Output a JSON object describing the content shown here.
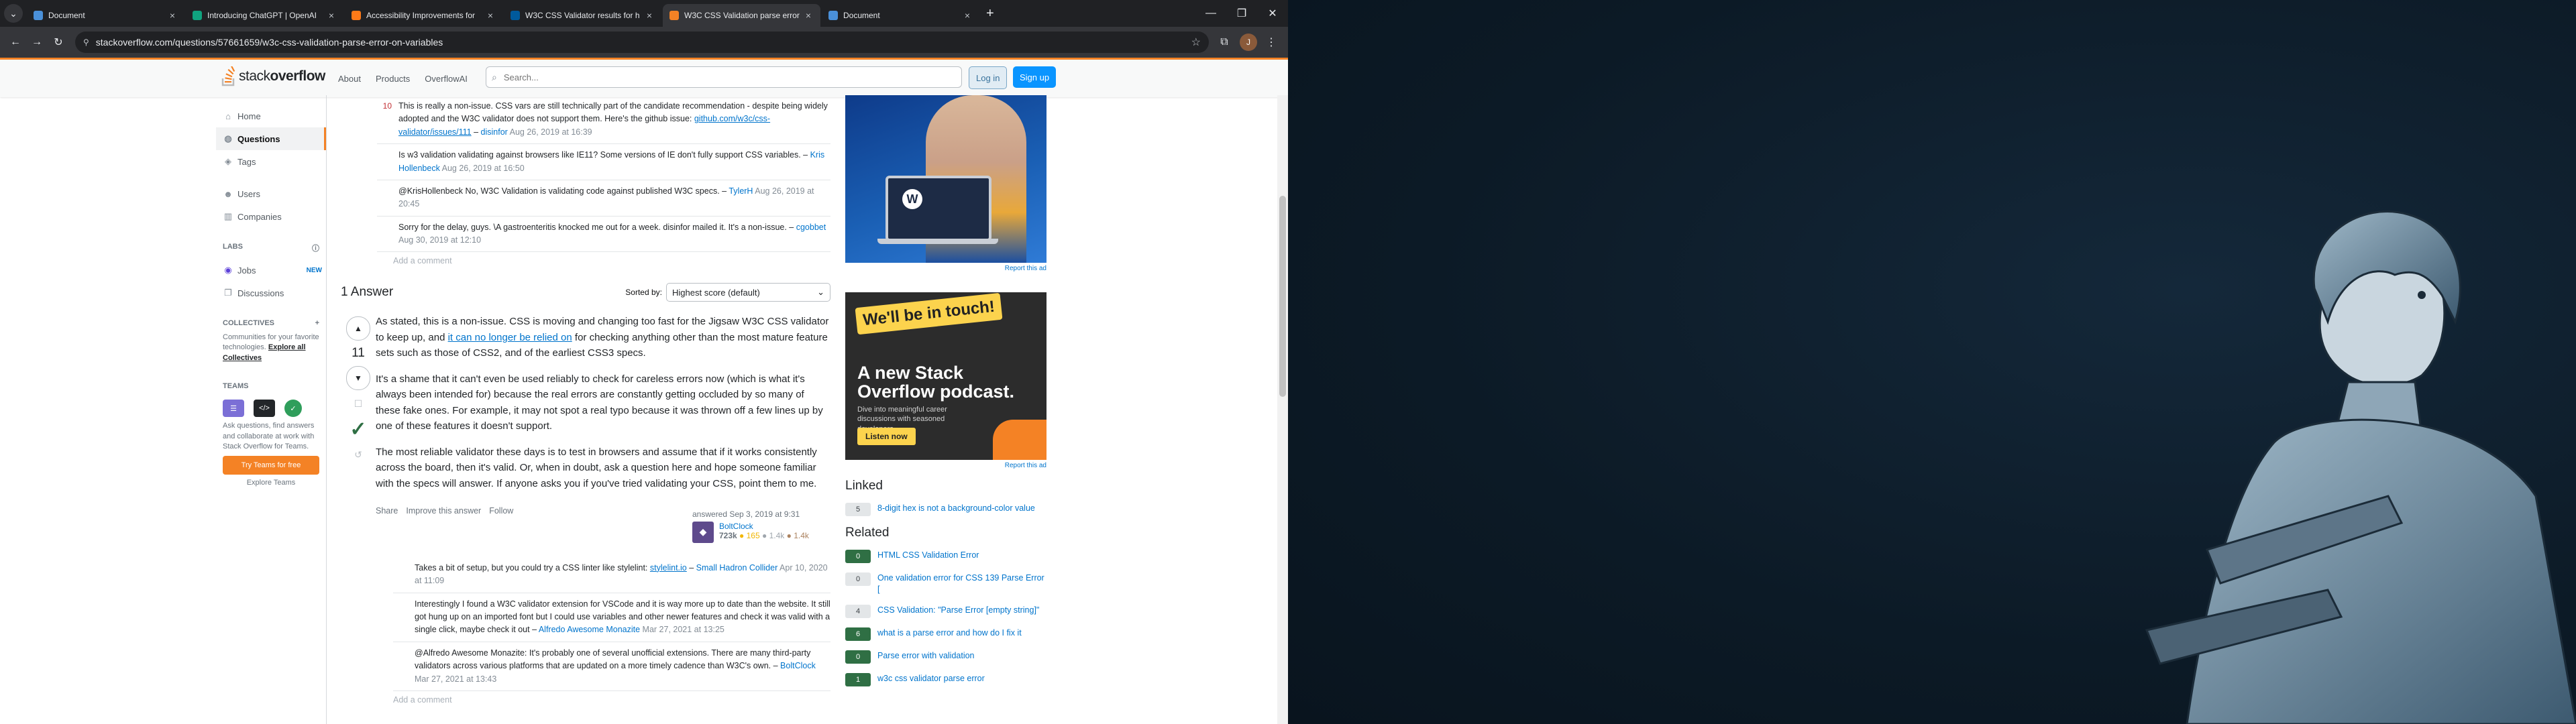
{
  "browser": {
    "tabs": [
      {
        "title": "Document",
        "color": "#4a90d9",
        "active": false
      },
      {
        "title": "Introducing ChatGPT | OpenAI",
        "color": "#10a37f",
        "active": false
      },
      {
        "title": "Accessibility Improvements for",
        "color": "#ff7a18",
        "active": false
      },
      {
        "title": "W3C CSS Validator results for h",
        "color": "#005a9c",
        "active": false
      },
      {
        "title": "W3C CSS Validation parse error",
        "color": "#f48225",
        "active": true
      },
      {
        "title": "Document",
        "color": "#4a90d9",
        "active": false
      }
    ],
    "url": "stackoverflow.com/questions/57661659/w3c-css-validation-parse-error-on-variables",
    "avatar_letter": "J"
  },
  "so": {
    "logo_plain": "stack",
    "logo_bold": "overflow",
    "nav": [
      "About",
      "Products",
      "OverflowAI"
    ],
    "search_placeholder": "Search...",
    "login": "Log in",
    "signup": "Sign up"
  },
  "sidebar": {
    "home": "Home",
    "questions": "Questions",
    "tags": "Tags",
    "users": "Users",
    "companies": "Companies",
    "labs": "LABS",
    "jobs": "Jobs",
    "jobs_badge": "NEW",
    "discussions": "Discussions",
    "collectives": "COLLECTIVES",
    "collectives_text": "Communities for your favorite technologies.",
    "collectives_link": "Explore all Collectives",
    "teams": "TEAMS",
    "teams_text": "Ask questions, find answers and collaborate at work with Stack Overflow for Teams.",
    "teams_btn": "Try Teams for free",
    "teams_explore": "Explore Teams"
  },
  "question_comments": [
    {
      "score": "10",
      "text": "This is really a non-issue. CSS vars are still technically part of the candidate recommendation - despite being widely adopted and the W3C validator does not support them. Here's the github issue: ",
      "link": "github.com/w3c/css-validator/issues/111",
      "dash": " – ",
      "user": "disinfor",
      "date": "Aug 26, 2019 at 16:39"
    },
    {
      "score": "",
      "text": "Is w3 validation validating against browsers like IE11? Some versions of IE don't fully support CSS variables.",
      "link": "",
      "dash": " – ",
      "user": "Kris Hollenbeck",
      "date": "Aug 26, 2019 at 16:50"
    },
    {
      "score": "",
      "text": "@KrisHollenbeck No, W3C Validation is validating code against published W3C specs.",
      "link": "",
      "dash": " – ",
      "user": "TylerH",
      "date": "Aug 26, 2019 at 20:45"
    },
    {
      "score": "",
      "text": "Sorry for the delay, guys. \\A gastroenteritis knocked me out for a week. disinfor mailed it. It's a non-issue.",
      "link": "",
      "dash": " – ",
      "user": "cgobbet",
      "date": "Aug 30, 2019 at 12:10"
    }
  ],
  "add_comment": "Add a comment",
  "answers": {
    "count_label": "1 Answer",
    "sorted_by": "Sorted by:",
    "sort_value": "Highest score (default)"
  },
  "answer": {
    "score": "11",
    "p1_a": "As stated, this is a non-issue. CSS is moving and changing too fast for the Jigsaw W3C CSS validator to keep up, and ",
    "p1_link": "it can no longer be relied on",
    "p1_b": " for checking anything other than the most mature feature sets such as those of CSS2, and of the earliest CSS3 specs.",
    "p2": "It's a shame that it can't even be used reliably to check for careless errors now (which is what it's always been intended for) because the real errors are constantly getting occluded by so many of these fake ones. For example, it may not spot a real typo because it was thrown off a few lines up by one of these features it doesn't support.",
    "p3": "The most reliable validator these days is to test in browsers and assume that if it works consistently across the board, then it's valid. Or, when in doubt, ask a question here and hope someone familiar with the specs will answer. If anyone asks you if you've tried validating your CSS, point them to me.",
    "menu": [
      "Share",
      "Improve this answer",
      "Follow"
    ],
    "answered": "answered Sep 3, 2019 at 9:31",
    "user": "BoltClock",
    "rep": "723k",
    "gold": "● 165",
    "silver": "● 1.4k",
    "bronze": "● 1.4k"
  },
  "answer_comments": [
    {
      "text": "Takes a bit of setup, but you could try a CSS linter like stylelint: ",
      "link": "stylelint.io",
      "dash": " – ",
      "user": "Small Hadron Collider",
      "date": "Apr 10, 2020 at 11:09"
    },
    {
      "text": "Interestingly I found a W3C validator extension for VSCode and it is way more up to date than the website. It still got hung up on an imported font but I could use variables and other newer features and check it was valid with a single click, maybe check it out",
      "link": "",
      "dash": " – ",
      "user": "Alfredo Awesome Monazite",
      "date": "Mar 27, 2021 at 13:25"
    },
    {
      "text": "@Alfredo Awesome Monazite: It's probably one of several unofficial extensions. There are many third-party validators across various platforms that are updated on a more timely cadence than W3C's own.",
      "link": "",
      "dash": " – ",
      "user": "BoltClock",
      "date": "Mar 27, 2021 at 13:43"
    }
  ],
  "ads": {
    "report": "Report this ad",
    "podcast_tag": "We'll be in touch!",
    "podcast_head": "A new Stack Overflow podcast.",
    "podcast_sub": "Dive into meaningful career discussions with seasoned developers.",
    "podcast_btn": "Listen now",
    "wp_letter": "W"
  },
  "linked": {
    "title": "Linked",
    "items": [
      {
        "score": "5",
        "text": "8-digit hex is not a background-color value",
        "answered": false
      }
    ]
  },
  "related": {
    "title": "Related",
    "items": [
      {
        "score": "0",
        "text": "HTML CSS Validation Error",
        "answered": true
      },
      {
        "score": "0",
        "text": "One validation error for CSS 139 Parse Error [",
        "answered": false
      },
      {
        "score": "4",
        "text": "CSS Validation: \"Parse Error [empty string]\"",
        "answered": false
      },
      {
        "score": "6",
        "text": "what is a parse error and how do I fix it",
        "answered": true
      },
      {
        "score": "0",
        "text": "Parse error with validation",
        "answered": true
      },
      {
        "score": "1",
        "text": "w3c css validator parse error",
        "answered": true
      }
    ]
  }
}
